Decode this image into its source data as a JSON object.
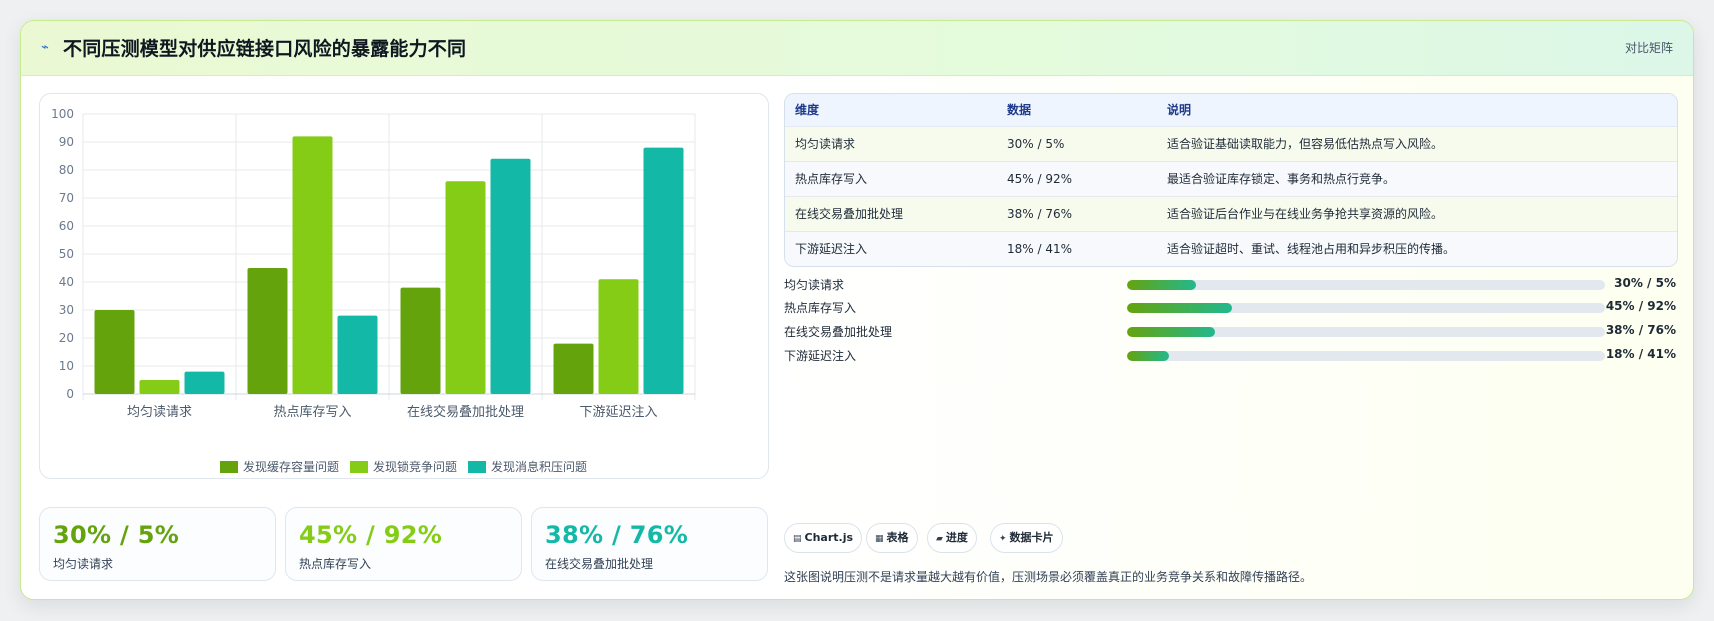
{
  "header": {
    "icon": "lightning-icon",
    "title": "不同压测模型对供应链接口风险的暴露能力不同",
    "action_label": "对比矩阵"
  },
  "chart_data": {
    "type": "bar",
    "title": "",
    "xlabel": "",
    "ylabel": "",
    "ylim": [
      0,
      100
    ],
    "yticks": [
      0,
      10,
      20,
      30,
      40,
      50,
      60,
      70,
      80,
      90,
      100
    ],
    "categories": [
      "均匀读请求",
      "热点库存写入",
      "在线交易叠加批处理",
      "下游延迟注入"
    ],
    "series": [
      {
        "name": "发现缓存容量问题",
        "values": [
          30,
          45,
          38,
          18
        ],
        "color": "#65a30d"
      },
      {
        "name": "发现锁竞争问题",
        "values": [
          5,
          92,
          76,
          41
        ],
        "color": "#84cc16"
      },
      {
        "name": "发现消息积压问题",
        "values": [
          8,
          28,
          84,
          88
        ],
        "color": "#14b8a6"
      }
    ],
    "legend_position": "bottom",
    "grid": true
  },
  "stats": [
    {
      "value": "30% / 5%",
      "label": "均匀读请求",
      "color": "#65a30d"
    },
    {
      "value": "45% / 92%",
      "label": "热点库存写入",
      "color": "#84cc16"
    },
    {
      "value": "38% / 76%",
      "label": "在线交易叠加批处理",
      "color": "#14b8a6"
    }
  ],
  "table": {
    "headers": [
      "维度",
      "数据",
      "说明"
    ],
    "rows": [
      [
        "均匀读请求",
        "30% / 5%",
        "适合验证基础读取能力，但容易低估热点写入风险。"
      ],
      [
        "热点库存写入",
        "45% / 92%",
        "最适合验证库存锁定、事务和热点行竞争。"
      ],
      [
        "在线交易叠加批处理",
        "38% / 76%",
        "适合验证后台作业与在线业务争抢共享资源的风险。"
      ],
      [
        "下游延迟注入",
        "18% / 41%",
        "适合验证超时、重试、线程池占用和异步积压的传播。"
      ]
    ]
  },
  "progress": [
    {
      "label": "均匀读请求",
      "value": "30% / 5%",
      "fraction": 0.145
    },
    {
      "label": "热点库存写入",
      "value": "45% / 92%",
      "fraction": 0.22
    },
    {
      "label": "在线交易叠加批处理",
      "value": "38% / 76%",
      "fraction": 0.185
    },
    {
      "label": "下游延迟注入",
      "value": "18% / 41%",
      "fraction": 0.087
    }
  ],
  "chips": [
    {
      "icon": "chart-icon",
      "glyph": "▤",
      "label": "Chart.js"
    },
    {
      "icon": "table-icon",
      "glyph": "▦",
      "label": "表格"
    },
    {
      "icon": "progress-icon",
      "glyph": "▰",
      "label": "进度"
    },
    {
      "icon": "sparkle-icon",
      "glyph": "✦",
      "label": "数据卡片"
    }
  ],
  "footnote": "这张图说明压测不是请求量越大越有价值，压测场景必须覆盖真正的业务竞争关系和故障传播路径。"
}
